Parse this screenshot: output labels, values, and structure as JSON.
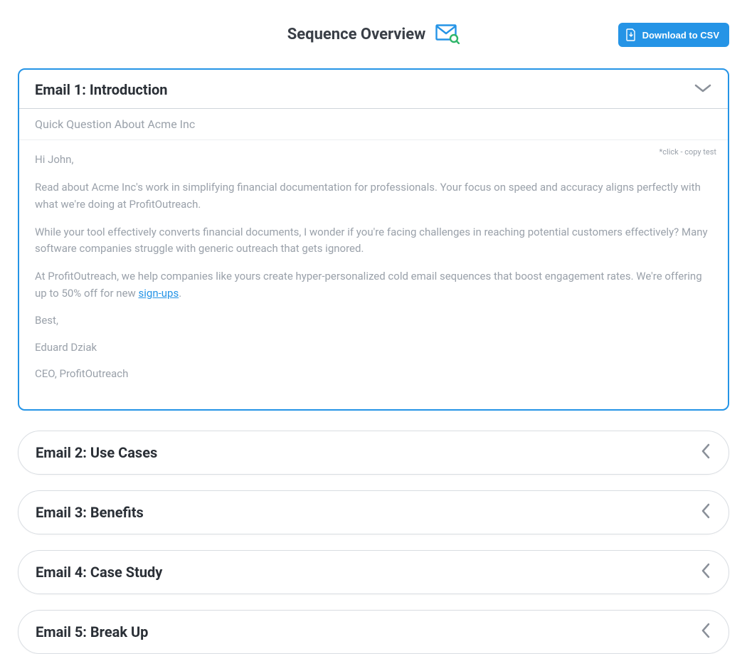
{
  "header": {
    "title": "Sequence Overview",
    "download_label": "Download to CSV"
  },
  "emails": [
    {
      "title": "Email 1: Introduction",
      "subject": "Quick Question About Acme Inc",
      "copy_hint": "*click - copy test",
      "greeting": "Hi John,",
      "p1": "Read about Acme Inc's work in simplifying financial documentation for professionals. Your focus on speed and accuracy aligns perfectly with what we're doing at ProfitOutreach.",
      "p2": "While your tool effectively converts financial documents, I wonder if you're facing challenges in reaching potential customers effectively? Many software companies struggle with generic outreach that gets ignored.",
      "p3_before": "At ProfitOutreach, we help companies like yours create hyper-personalized cold email sequences that boost engagement rates. We're offering up to 50% off for new ",
      "p3_link": "sign-ups",
      "p3_after": ".",
      "sig1": "Best,",
      "sig2": "Eduard Dziak",
      "sig3": "CEO, ProfitOutreach"
    },
    {
      "title": "Email 2: Use Cases"
    },
    {
      "title": "Email 3: Benefits"
    },
    {
      "title": "Email 4: Case Study"
    },
    {
      "title": "Email 5: Break Up"
    }
  ]
}
